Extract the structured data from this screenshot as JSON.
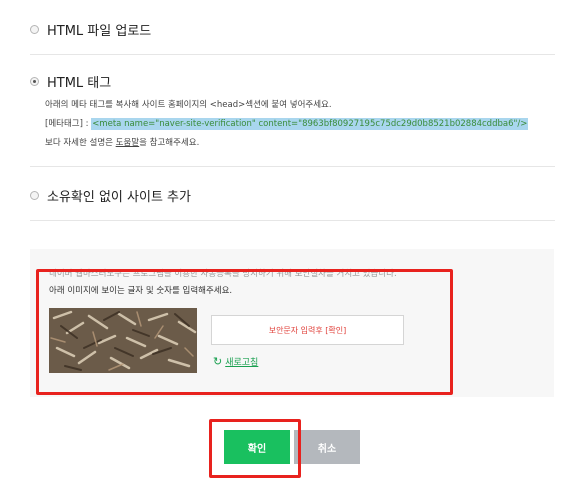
{
  "options": {
    "html_file_upload": "HTML 파일 업로드",
    "html_tag": "HTML 태그",
    "add_without_ownership": "소유확인 없이 사이트 추가"
  },
  "html_tag_section": {
    "instruction": "아래의 메타 태그를 복사해 사이트 홈페이지의 <head>섹션에 붙여 넣어주세요.",
    "meta_label": "[메타태그] : ",
    "meta_tag": "<meta name=\"naver-site-verification\" content=\"8963bf80927195c75dc29d0b8521b02884cddba6\"/>",
    "help_prefix": "보다 자세한 설명은 ",
    "help_link": "도움말",
    "help_suffix": "을 참고해주세요."
  },
  "captcha": {
    "faded_note": "네이버 웹마스터도구는 프로그램을 이용한 자동등록을 방지하기 위해 보안절차를 거치고 있습니다.",
    "instruction": "아래 이미지에 보이는 글자 및 숫자를 입력해주세요.",
    "input_placeholder": "보안문자 입력후 [확인]",
    "refresh_label": "새로고침"
  },
  "buttons": {
    "confirm": "확인",
    "cancel": "취소"
  },
  "colors": {
    "confirm_green": "#19c05f",
    "cancel_gray": "#b4b8bd",
    "highlight_red": "#e8221e",
    "meta_highlight": "#a9d6ee",
    "link_green": "#1aa050"
  }
}
